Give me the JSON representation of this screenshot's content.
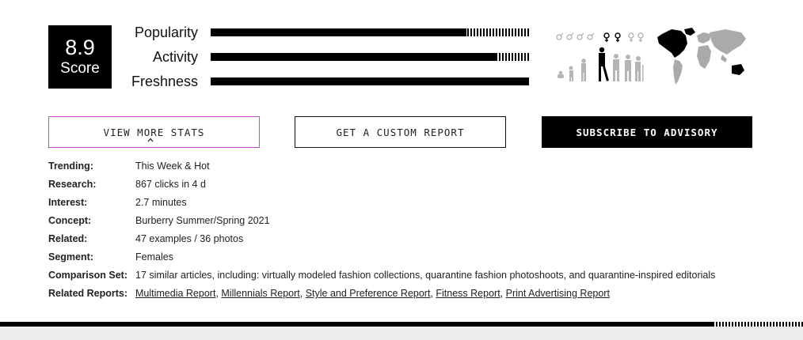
{
  "score": {
    "value": "8.9",
    "label": "Score"
  },
  "metrics": [
    {
      "label": "Popularity",
      "fill_percent": 80
    },
    {
      "label": "Activity",
      "fill_percent": 89
    },
    {
      "label": "Freshness",
      "fill_percent": 99
    }
  ],
  "icons": {
    "demographics": "gender-age-demographics-icon",
    "world_map": "world-map-icon"
  },
  "colors": {
    "accent_border": "#d048d0",
    "primary": "#000000",
    "footer_bg": "#eeeeee"
  },
  "buttons": {
    "view_more_stats": "VIEW MORE STATS",
    "custom_report": "GET A CUSTOM REPORT",
    "subscribe": "SUBSCRIBE TO ADVISORY"
  },
  "info": [
    {
      "key": "Trending:",
      "value": "This Week & Hot"
    },
    {
      "key": "Research:",
      "value": "867 clicks in 4 d"
    },
    {
      "key": "Interest:",
      "value": "2.7 minutes"
    },
    {
      "key": "Concept:",
      "value": "Burberry Summer/Spring 2021"
    },
    {
      "key": "Related:",
      "value": "47 examples / 36 photos"
    },
    {
      "key": "Segment:",
      "value": "Females"
    },
    {
      "key": "Comparison Set:",
      "value": "17 similar articles, including: virtually modeled fashion collections, quarantine fashion photoshoots, and quarantine-inspired editorials"
    }
  ],
  "related_reports": {
    "key": "Related Reports:",
    "links": [
      "Multimedia Report",
      "Millennials Report",
      "Style and Preference Report",
      "Fitness Report",
      "Print Advertising Report"
    ]
  },
  "page_progress_percent": 89
}
